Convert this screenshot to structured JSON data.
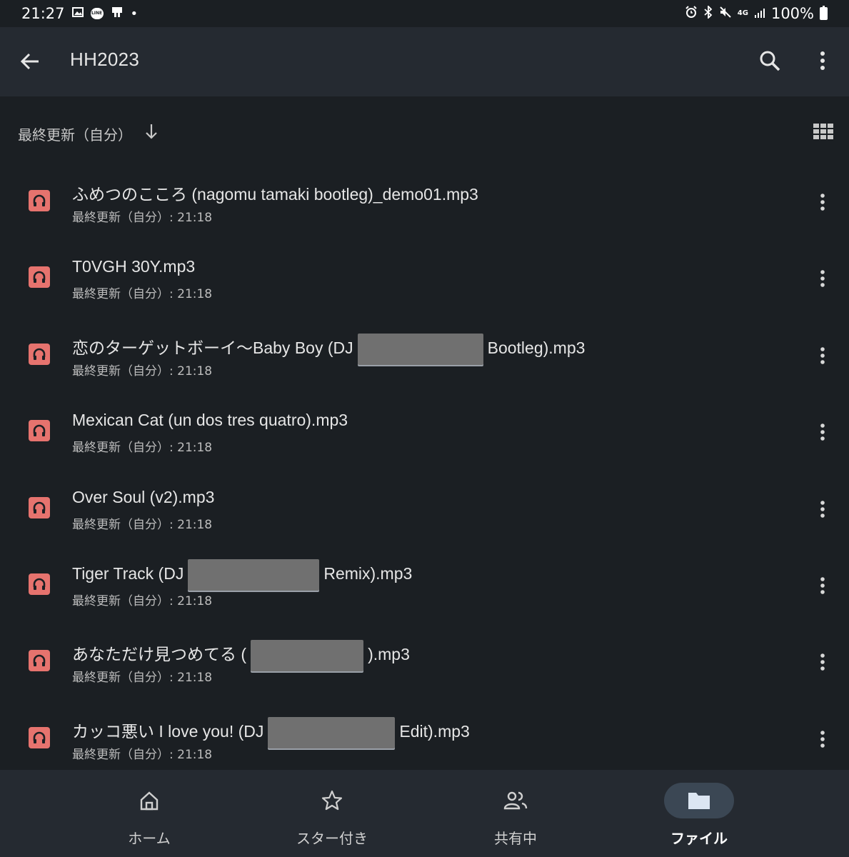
{
  "statusbar": {
    "time": "21:27",
    "left_icons": [
      "image-icon",
      "line-icon",
      "notification-icon",
      "dot-icon"
    ],
    "line_text": "LINE",
    "dot": "•",
    "signal_text": "4G",
    "battery_text": "100%"
  },
  "appbar": {
    "title": "HH2023"
  },
  "sort": {
    "label": "最終更新（自分）"
  },
  "files": [
    {
      "name_parts": [
        "ふめつのこころ (nagomu tamaki bootleg)_demo01.mp3"
      ],
      "redact_widths": [],
      "meta": "最終更新（自分）: 21:18"
    },
    {
      "name_parts": [
        "T0VGH 30Y.mp3"
      ],
      "redact_widths": [],
      "meta": "最終更新（自分）: 21:18"
    },
    {
      "name_parts": [
        "恋のターゲットボーイ〜Baby Boy (DJ",
        "Bootleg).mp3"
      ],
      "redact_widths": [
        176
      ],
      "meta": "最終更新（自分）: 21:18"
    },
    {
      "name_parts": [
        "Mexican Cat (un dos tres quatro).mp3"
      ],
      "redact_widths": [],
      "meta": "最終更新（自分）: 21:18"
    },
    {
      "name_parts": [
        "Over Soul (v2).mp3"
      ],
      "redact_widths": [],
      "meta": "最終更新（自分）: 21:18"
    },
    {
      "name_parts": [
        "Tiger Track (DJ",
        "Remix).mp3"
      ],
      "redact_widths": [
        184
      ],
      "meta": "最終更新（自分）: 21:18"
    },
    {
      "name_parts": [
        "あなただけ見つめてる (",
        ").mp3"
      ],
      "redact_widths": [
        158
      ],
      "meta": "最終更新（自分）: 21:18"
    },
    {
      "name_parts": [
        "カッコ悪い I love you! (DJ",
        "Edit).mp3"
      ],
      "redact_widths": [
        178
      ],
      "meta": "最終更新（自分）: 21:18"
    }
  ],
  "nav": {
    "items": [
      {
        "label": "ホーム",
        "icon": "home-icon",
        "active": false
      },
      {
        "label": "スター付き",
        "icon": "star-icon",
        "active": false
      },
      {
        "label": "共有中",
        "icon": "people-icon",
        "active": false
      },
      {
        "label": "ファイル",
        "icon": "folder-icon",
        "active": true
      }
    ]
  },
  "colors": {
    "background": "#1b1f23",
    "appbar": "#252a31",
    "audio_icon": "#e6736e",
    "nav_active_pill": "#3b4754",
    "redaction": "#707070"
  }
}
